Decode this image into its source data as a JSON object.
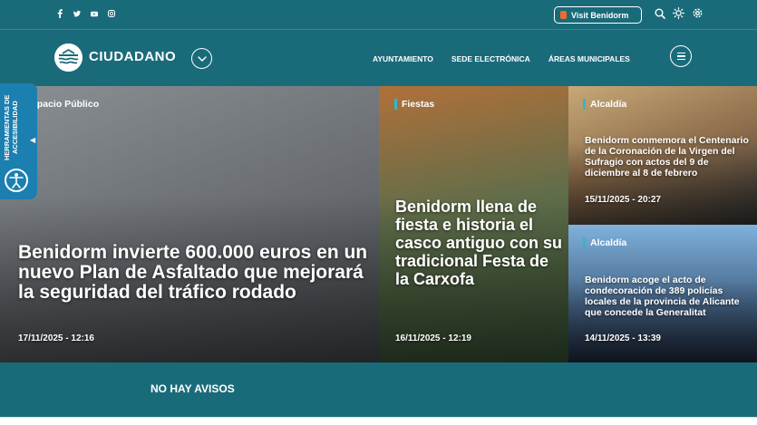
{
  "topbar": {
    "social_icons": [
      "facebook-icon",
      "twitter-icon",
      "youtube-icon",
      "instagram-icon"
    ],
    "visit_label": "Visit Benidorm",
    "tool_icons": [
      "search-icon",
      "brightness-icon",
      "gear-icon"
    ]
  },
  "header": {
    "brand": "CIUDADANO",
    "nav": [
      "AYUNTAMIENTO",
      "SEDE ELECTRÓNICA",
      "ÁREAS MUNICIPALES"
    ]
  },
  "accessibility": {
    "label": "HERRAMIENTAS DE ACCESIBILIDAD"
  },
  "news": [
    {
      "category": "Espacio Público",
      "title": "Benidorm invierte 600.000 euros en un nuevo Plan de Asfaltado que mejorará la seguridad del tráfico rodado",
      "date": "17/11/2025 - 12:16"
    },
    {
      "category": "Fiestas",
      "title": "Benidorm llena de fiesta e historia el casco antiguo con su tradicional Festa de la Carxofa",
      "date": "16/11/2025 - 12:19"
    },
    {
      "category": "Alcaldía",
      "title": "Benidorm conmemora el Centenario de la Coronación de la Virgen del Sufragio con actos del 9 de diciembre al 8 de febrero",
      "date": "15/11/2025 - 20:27"
    },
    {
      "category": "Alcaldía",
      "title": "Benidorm acoge el acto de condecoración de 389 policías locales de la provincia de Alicante que concede la Generalitat",
      "date": "14/11/2025 - 13:39"
    }
  ],
  "notices": {
    "label": "NO HAY AVISOS"
  },
  "colors": {
    "primary": "#1a6b7a",
    "accent": "#36b5c7",
    "accessibility": "#1b7fb0",
    "visit_dot": "#f26a2b"
  }
}
